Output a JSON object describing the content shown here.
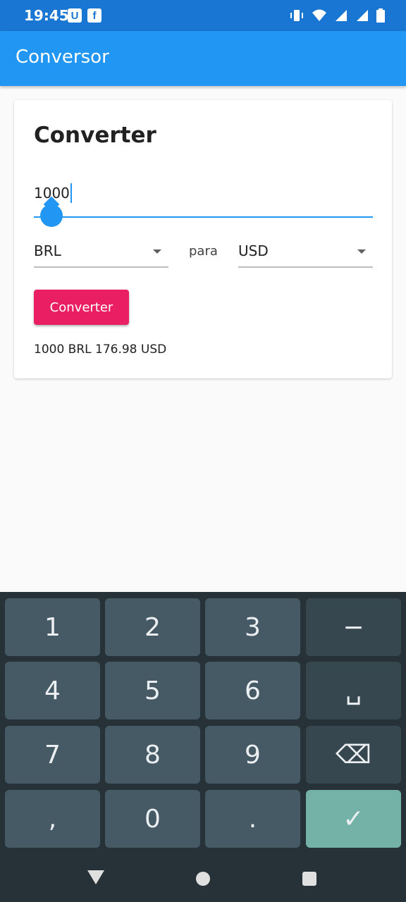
{
  "status_bar": {
    "time": "19:45",
    "left_icons": [
      "U",
      "f"
    ],
    "right_icons": [
      "vibrate-icon",
      "wifi-icon",
      "signal-icon",
      "signal-icon",
      "battery-icon"
    ]
  },
  "app_bar": {
    "title": "Conversor"
  },
  "card": {
    "title": "Converter",
    "amount_value": "1000",
    "from_currency": "BRL",
    "para_label": "para",
    "to_currency": "USD",
    "convert_button": "Converter",
    "result": "1000 BRL 176.98 USD"
  },
  "keyboard": {
    "rows": [
      [
        "1",
        "2",
        "3",
        "−"
      ],
      [
        "4",
        "5",
        "6",
        "␣"
      ],
      [
        "7",
        "8",
        "9",
        "⌫"
      ],
      [
        ",",
        "0",
        ".",
        "✓"
      ]
    ]
  },
  "colors": {
    "status_bar": "#1976d2",
    "app_bar": "#2196f3",
    "accent": "#e91e63",
    "done_key": "#74b2a8"
  }
}
